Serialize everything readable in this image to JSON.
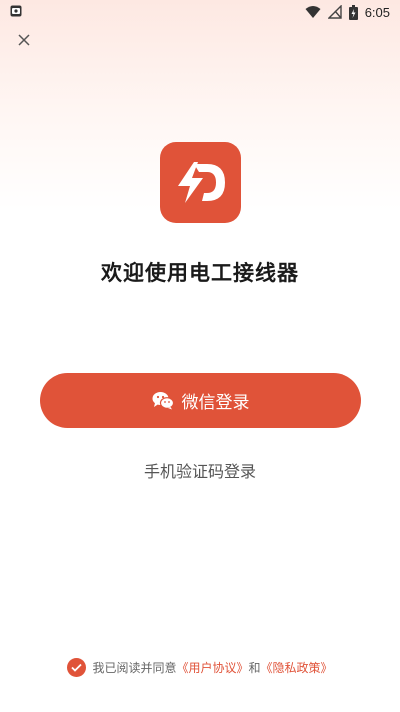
{
  "status_bar": {
    "time": "6:05"
  },
  "app": {
    "title": "欢迎使用电工接线器",
    "brand_color": "#e05339"
  },
  "actions": {
    "wechat_login": "微信登录",
    "phone_login": "手机验证码登录"
  },
  "agreement": {
    "prefix": "我已阅读并同意",
    "user_agreement": "《用户协议》",
    "conjunction": "和",
    "privacy_policy": "《隐私政策》",
    "checked": true
  },
  "icons": {
    "status_left": "photo-notification-icon",
    "wifi": "wifi-icon",
    "signal": "no-signal-icon",
    "battery": "battery-charging-icon",
    "close": "close-icon",
    "wechat": "wechat-icon",
    "check": "check-icon"
  }
}
